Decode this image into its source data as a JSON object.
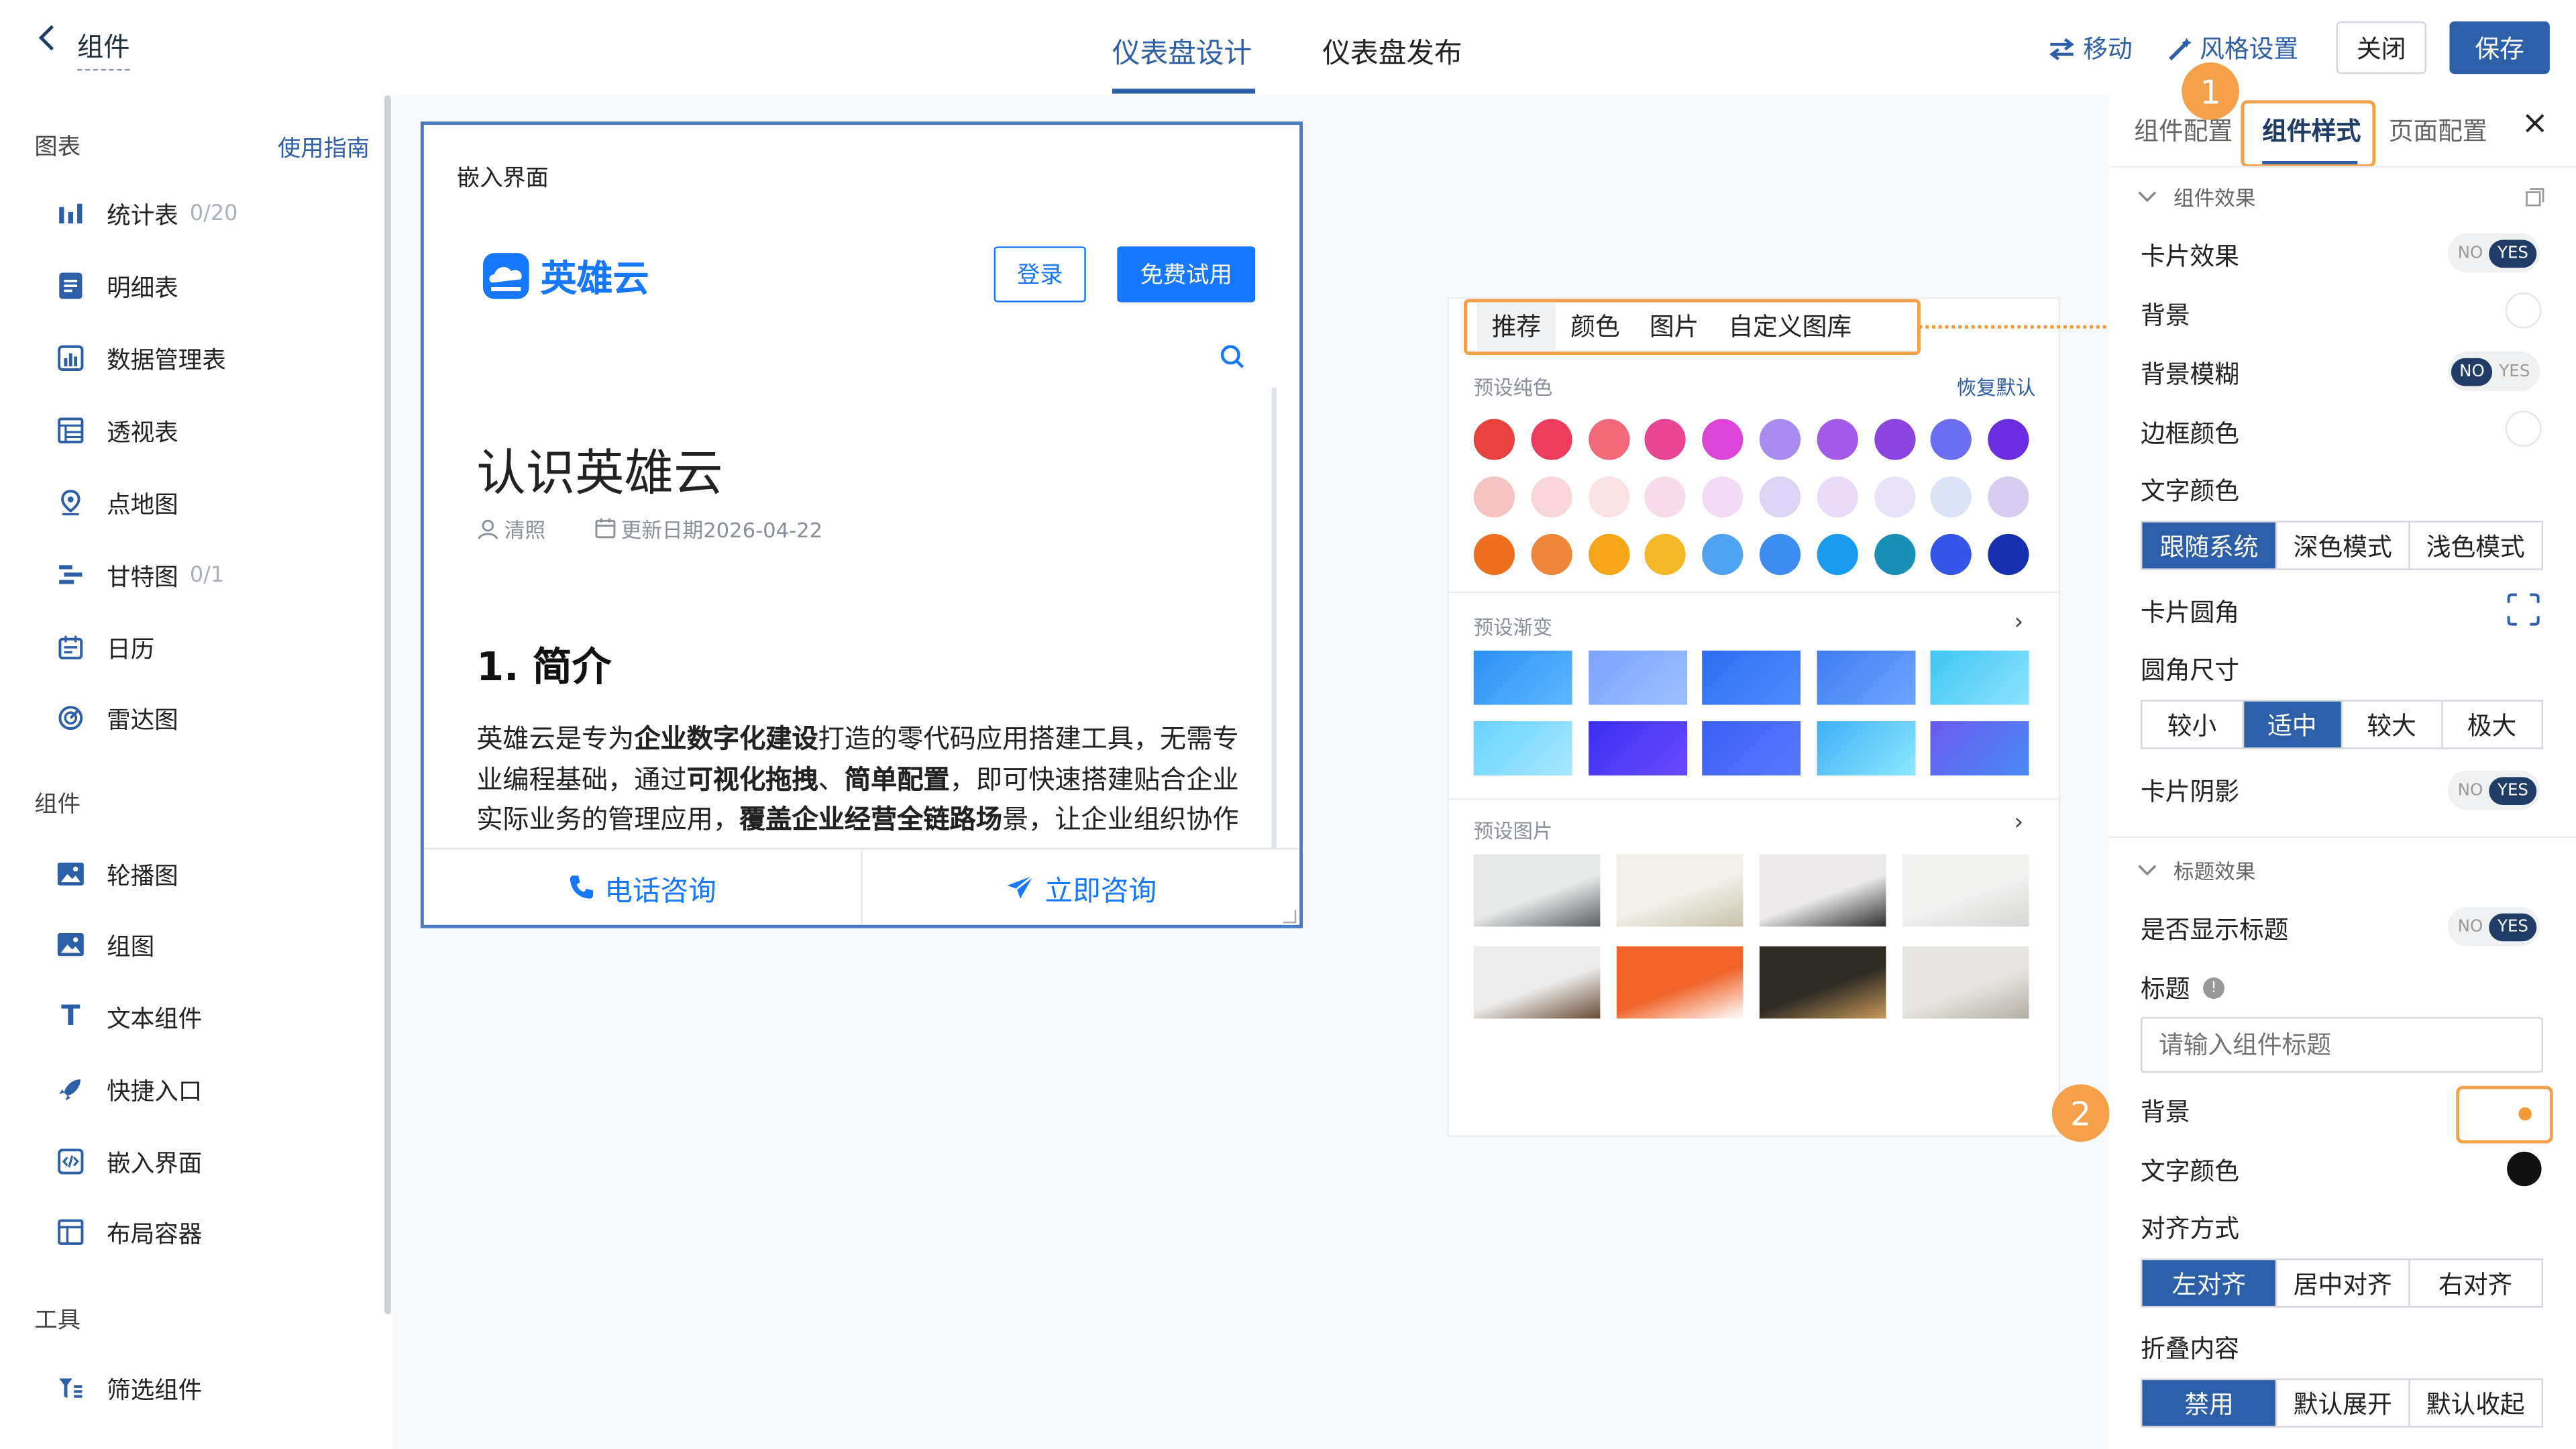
{
  "header": {
    "back_icon": "chevron-left-icon",
    "app_title": "组件",
    "tabs": [
      "仪表盘设计",
      "仪表盘发布"
    ],
    "active_tab": "仪表盘设计",
    "move_label": "移动",
    "style_settings_label": "风格设置",
    "close_label": "关闭",
    "save_label": "保存",
    "accent_color": "#2c5fa8"
  },
  "sidebar": {
    "section_charts": "图表",
    "guide_link": "使用指南",
    "charts": [
      {
        "label": "统计表",
        "count": "0/20",
        "icon": "bar-chart-icon"
      },
      {
        "label": "明细表",
        "count": "",
        "icon": "list-icon"
      },
      {
        "label": "数据管理表",
        "count": "",
        "icon": "data-table-icon"
      },
      {
        "label": "透视表",
        "count": "",
        "icon": "pivot-table-icon"
      },
      {
        "label": "点地图",
        "count": "",
        "icon": "map-pin-icon"
      },
      {
        "label": "甘特图",
        "count": "0/1",
        "icon": "gantt-icon"
      },
      {
        "label": "日历",
        "count": "",
        "icon": "calendar-icon"
      },
      {
        "label": "雷达图",
        "count": "",
        "icon": "radar-icon"
      }
    ],
    "section_components": "组件",
    "components": [
      {
        "label": "轮播图",
        "icon": "carousel-icon"
      },
      {
        "label": "组图",
        "icon": "image-group-icon"
      },
      {
        "label": "文本组件",
        "icon": "text-icon"
      },
      {
        "label": "快捷入口",
        "icon": "rocket-icon"
      },
      {
        "label": "嵌入界面",
        "icon": "embed-icon"
      },
      {
        "label": "布局容器",
        "icon": "layout-icon"
      }
    ],
    "section_tools": "工具",
    "tools": [
      {
        "label": "筛选组件",
        "icon": "filter-icon"
      }
    ]
  },
  "embed_card": {
    "title": "嵌入界面",
    "logo_text": "英雄云",
    "login_label": "登录",
    "trial_label": "免费试用",
    "article_title": "认识英雄云",
    "author": "清照",
    "updated": "更新日期2026-04-22",
    "heading": "1. 简介",
    "para": [
      {
        "t": "英雄云是专为",
        "b": false
      },
      {
        "t": "企业数字化建设",
        "b": true
      },
      {
        "t": "打造的零代码应用搭建工具，无需专业编程基础，通过",
        "b": false
      },
      {
        "t": "可视化拖拽",
        "b": true
      },
      {
        "t": "、",
        "b": false
      },
      {
        "t": "简单配置",
        "b": true
      },
      {
        "t": "，即可快速搭建贴合企业实际业务的管理应用，",
        "b": false
      },
      {
        "t": "覆盖企业经营全链路场",
        "b": true
      },
      {
        "t": "景，让企业组织协作更顺畅、业务运转更高效，助力数字化升级。",
        "b": false
      }
    ],
    "phone_label": "电话咨询",
    "consult_label": "立即咨询"
  },
  "picker": {
    "tabs": [
      "推荐",
      "颜色",
      "图片",
      "自定义图库"
    ],
    "active_tab": "推荐",
    "solid_label": "预设纯色",
    "reset_label": "恢复默认",
    "solid_colors": [
      [
        "#e8413e",
        "#ee3d5c",
        "#f2697a",
        "#e84593",
        "#dd45d8",
        "#a98bf0",
        "#a45ae8",
        "#8a45e0",
        "#6a6ef0",
        "#6a2ee0"
      ],
      [
        "#f6c3c3",
        "#f9d6d9",
        "#fbe3e5",
        "#f8dcec",
        "#f3dbf5",
        "#ddd3f5",
        "#eadbf8",
        "#e8e3f8",
        "#dde3f6",
        "#d8cdf0"
      ],
      [
        "#f07020",
        "#f0863a",
        "#f5a51a",
        "#f5b828",
        "#4fa3f0",
        "#3d8df0",
        "#1a9bef",
        "#1a8fb8",
        "#3656e8",
        "#1830b0"
      ]
    ],
    "gradient_label": "预设渐变",
    "gradients": [
      [
        "#2b8ff5",
        "#5fb8ff"
      ],
      [
        "#7aa2ff",
        "#9fc0ff"
      ],
      [
        "#2e6df0",
        "#4f8bff"
      ],
      [
        "#3f7cf2",
        "#6ea6ff"
      ],
      [
        "#3ec6f2",
        "#8fe2ff"
      ],
      [
        "#68d2ff",
        "#a8e8ff"
      ],
      [
        "#3a2ef0",
        "#6a4bff"
      ],
      [
        "#3a60f0",
        "#5a78ff"
      ],
      [
        "#3fb0f5",
        "#8ee8ff"
      ],
      [
        "#6a5af0",
        "#4a8af5"
      ]
    ],
    "image_label": "预设图片",
    "images": [
      [
        "#e8eaea",
        "#5a5f63"
      ],
      [
        "#f0efe8",
        "#c8c2a8"
      ],
      [
        "#eceaea",
        "#2e2e30"
      ],
      [
        "#f1f1f0",
        "#d6d6d4"
      ],
      [
        "#ececec",
        "#6a4a32"
      ],
      [
        "#f0642a",
        "#ffffff"
      ],
      [
        "#2e2a24",
        "#c89a5a"
      ],
      [
        "#e8e6e2",
        "#b4aea4"
      ]
    ]
  },
  "rpanel": {
    "tabs": [
      "组件配置",
      "组件样式",
      "页面配置"
    ],
    "active_tab": "组件样式",
    "close_icon": "close-icon",
    "marker1": "1",
    "marker2": "2",
    "group1": "组件效果",
    "card_effect": "卡片效果",
    "background": "背景",
    "bg_blur": "背景模糊",
    "border_color": "边框颜色",
    "text_color": "文字颜色",
    "text_mode_options": [
      "跟随系统",
      "深色模式",
      "浅色模式"
    ],
    "text_mode_selected": "跟随系统",
    "card_radius": "卡片圆角",
    "radius_size": "圆角尺寸",
    "radius_options": [
      "较小",
      "适中",
      "较大",
      "极大"
    ],
    "radius_selected": "适中",
    "card_shadow": "卡片阴影",
    "group2": "标题效果",
    "show_title": "是否显示标题",
    "title_label": "标题",
    "title_placeholder": "请输入组件标题",
    "title_bg": "背景",
    "title_text_color": "文字颜色",
    "align_label": "对齐方式",
    "align_options": [
      "左对齐",
      "居中对齐",
      "右对齐"
    ],
    "align_selected": "左对齐",
    "collapse_label": "折叠内容",
    "collapse_options": [
      "禁用",
      "默认展开",
      "默认收起"
    ],
    "collapse_selected": "禁用",
    "toggle_no": "NO",
    "toggle_yes": "YES",
    "card_effect_on": true,
    "bg_blur_on": false,
    "card_shadow_on": true,
    "show_title_on": true,
    "highlight_color": "#f5a04a"
  }
}
